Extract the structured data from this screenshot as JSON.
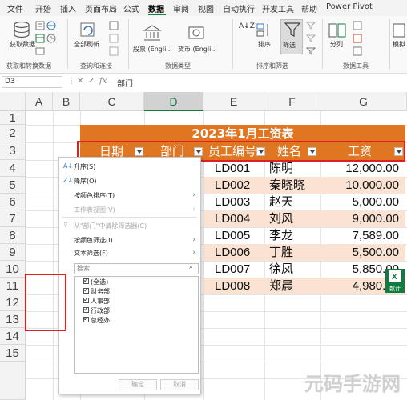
{
  "ribbon_tabs": [
    "文件",
    "开始",
    "插入",
    "页面布局",
    "公式",
    "数据",
    "审阅",
    "视图",
    "自动执行",
    "开发工具",
    "帮助",
    "Power Pivot"
  ],
  "active_tab": "数据",
  "ribbon": {
    "get_data": "获取数据",
    "refresh_all": "全部刷新",
    "stocks": "股票 (Engli...",
    "currencies": "货币 (Engli...",
    "sort_az": "A↓Z",
    "sort": "排序",
    "filter": "筛选",
    "split": "分列",
    "model": "模拟",
    "groups": {
      "get_transform": "获取和转换数据",
      "queries": "查询和连接",
      "data_types": "数据类型",
      "sort_filter": "排序和筛选",
      "data_tools": "数据工具"
    }
  },
  "formula_bar": {
    "name_box": "D3",
    "value": "部门"
  },
  "columns": [
    "A",
    "B",
    "C",
    "D",
    "E",
    "F",
    "G"
  ],
  "selected_column": "D",
  "rows": [
    "1",
    "2",
    "3",
    "4",
    "5",
    "6",
    "7",
    "8",
    "9",
    "10",
    "11",
    "12",
    "13",
    "14",
    "15"
  ],
  "table": {
    "title": "2023年1月工资表",
    "headers": [
      "日期",
      "部门",
      "员工编号",
      "姓名",
      "工资"
    ],
    "rows": [
      {
        "id": "LD001",
        "name": "陈明",
        "salary": "12,000.00"
      },
      {
        "id": "LD002",
        "name": "秦晓晓",
        "salary": "10,000.00"
      },
      {
        "id": "LD003",
        "name": "赵天",
        "salary": "5,000.00"
      },
      {
        "id": "LD004",
        "name": "刘风",
        "salary": "9,000.00"
      },
      {
        "id": "LD005",
        "name": "李龙",
        "salary": "7,589.00"
      },
      {
        "id": "LD006",
        "name": "丁胜",
        "salary": "5,500.00"
      },
      {
        "id": "LD007",
        "name": "徐凤",
        "salary": "5,850.00"
      },
      {
        "id": "LD008",
        "name": "郑晨",
        "salary": "4,980.00"
      }
    ]
  },
  "filter_menu": {
    "sort_asc": "升序(S)",
    "sort_desc": "降序(O)",
    "sort_by_color": "按颜色排序(T)",
    "sheet_view": "工作表视图(V)",
    "clear_filter": "从\"部门\"中清除筛选器(C)",
    "filter_by_color": "按颜色筛选(I)",
    "text_filter": "文本筛选(F)",
    "search_placeholder": "搜索",
    "checklist": [
      "(全选)",
      "财务部",
      "人事部",
      "行政部",
      "总经办"
    ],
    "ok": "确定",
    "cancel": "取消"
  },
  "sheet_badge": "数计",
  "watermark": "元码手游网",
  "colors": {
    "accent": "#107c41",
    "table_header": "#e07622",
    "table_alt_row": "#fbe3d3",
    "highlight_box": "#e02020"
  }
}
